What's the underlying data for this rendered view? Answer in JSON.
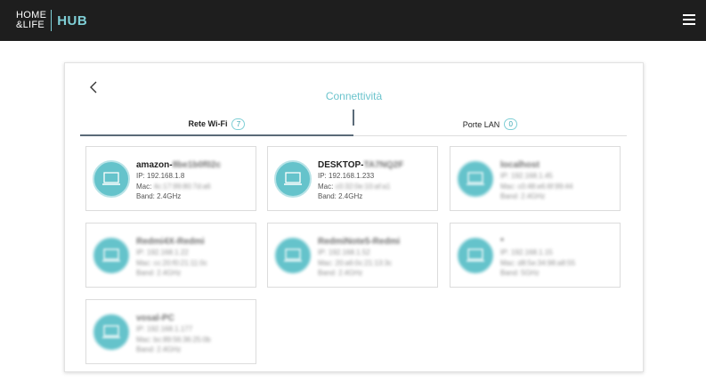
{
  "header": {
    "logo_line1": "HOME",
    "logo_line2": "&LIFE",
    "logo_hub": "HUB",
    "menu_icon": "hamburger-icon",
    "bg_color": "#1e1e1e",
    "accent": "#7fcfd6"
  },
  "page": {
    "back_icon": "chevron-left-icon",
    "title": "Connettività"
  },
  "tabs": [
    {
      "label": "Rete Wi-Fi",
      "count": "7",
      "active": true
    },
    {
      "label": "Porte LAN",
      "count": "0",
      "active": false
    }
  ],
  "devices": [
    {
      "name": "amazon-",
      "name_hidden": "8be1b0f02c",
      "ip": "IP: 192.168.1.8",
      "mac_label": "Mac:",
      "mac": "4c:17:99:80:7d:a6",
      "band": "Band: 2.4GHz"
    },
    {
      "name": "DESKTOP-",
      "name_hidden": "TA7NQ2F",
      "ip": "IP: 192.168.1.233",
      "mac_label": "Mac:",
      "mac": "c0:32:0e:10:af:a1",
      "band": "Band: 2.4GHz"
    },
    {
      "name": "",
      "name_hidden": "localhost",
      "ip": "IP: 192.168.1.45",
      "mac_label": "",
      "mac": "Mac: c0:48:e6:6f:99:44",
      "band": "Band: 2.4GHz"
    },
    {
      "name": "",
      "name_hidden": "Redmi4X-Redmi",
      "ip": "IP: 192.168.1.22",
      "mac_label": "",
      "mac": "Mac: cc:20:f0:21:11:0c",
      "band": "Band: 2.4GHz"
    },
    {
      "name": "",
      "name_hidden": "RedmiNote5-Redmi",
      "ip": "IP: 192.168.1.52",
      "mac_label": "",
      "mac": "Mac: 20:a6:0c:21:13:3c",
      "band": "Band: 2.4GHz"
    },
    {
      "name": "",
      "name_hidden": "*",
      "ip": "IP: 192.168.1.15",
      "mac_label": "",
      "mac": "Mac: d8:5e:34:98:a8:55",
      "band": "Band: 5GHz"
    },
    {
      "name": "",
      "name_hidden": "vosal-PC",
      "ip": "IP: 192.168.1.177",
      "mac_label": "",
      "mac": "Mac: bc:89:56:36:25:0b",
      "band": "Band: 2.4GHz"
    }
  ],
  "device_icon": "laptop-icon",
  "icon_color": "#65c3cb"
}
